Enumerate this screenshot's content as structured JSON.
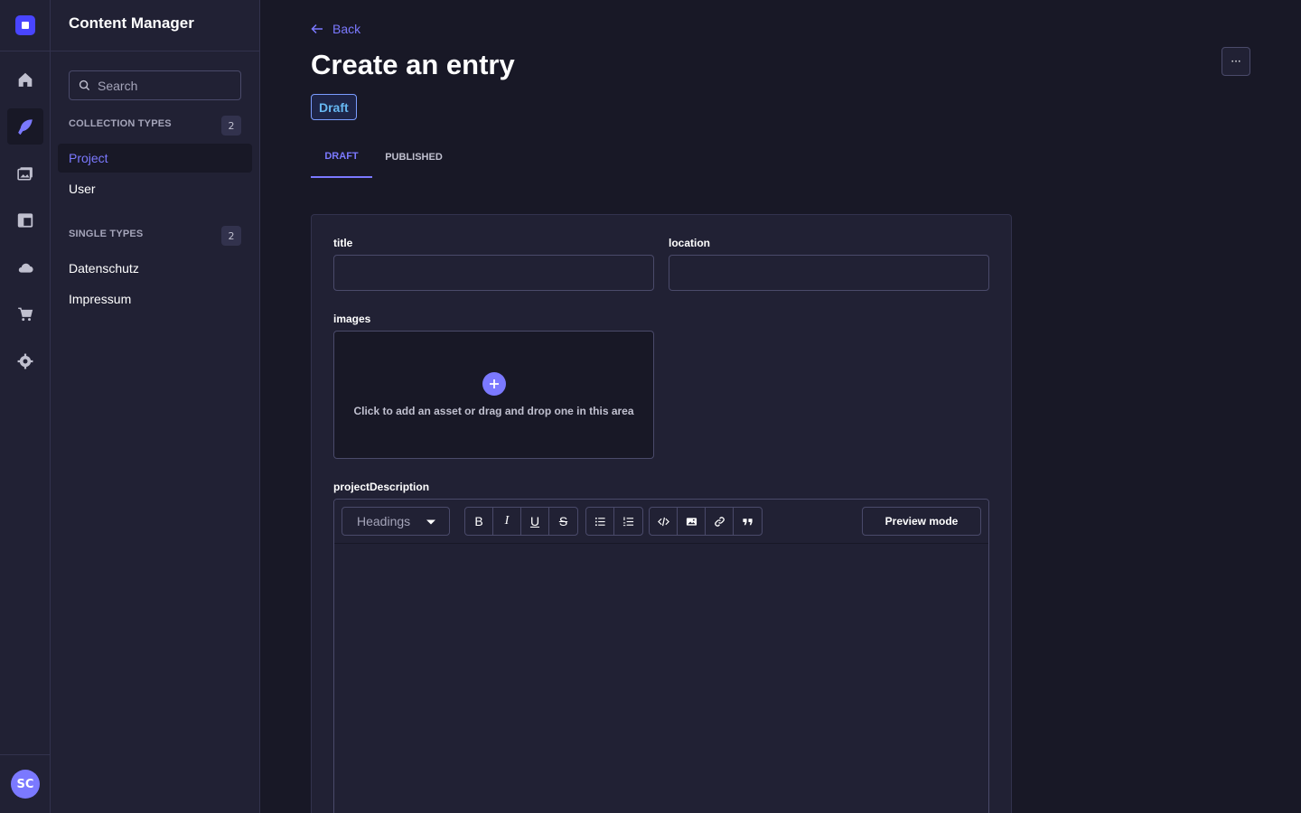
{
  "app": {
    "title": "Content Manager"
  },
  "rail": {
    "items": [
      {
        "icon": "logo-icon"
      },
      {
        "icon": "home-icon"
      },
      {
        "icon": "feather-icon",
        "active": true
      },
      {
        "icon": "media-library-icon"
      },
      {
        "icon": "layout-icon"
      },
      {
        "icon": "cloud-icon"
      },
      {
        "icon": "cart-icon"
      },
      {
        "icon": "gear-icon"
      }
    ],
    "avatar_initials": "SC"
  },
  "subnav": {
    "search_placeholder": "Search",
    "collection_types": {
      "label": "COLLECTION TYPES",
      "count": "2",
      "items": [
        {
          "label": "Project",
          "active": true
        },
        {
          "label": "User"
        }
      ]
    },
    "single_types": {
      "label": "SINGLE TYPES",
      "count": "2",
      "items": [
        {
          "label": "Datenschutz"
        },
        {
          "label": "Impressum"
        }
      ]
    }
  },
  "header": {
    "back_label": "Back",
    "title": "Create an entry",
    "status_badge": "Draft",
    "more_label": "···"
  },
  "tabs": [
    {
      "label": "DRAFT",
      "active": true
    },
    {
      "label": "PUBLISHED"
    }
  ],
  "form": {
    "title_label": "title",
    "title_value": "",
    "location_label": "location",
    "location_value": "",
    "images_label": "images",
    "images_prompt": "Click to add an asset or drag and drop one in this area",
    "description_label": "projectDescription",
    "editor": {
      "headings_label": "Headings",
      "bold": "B",
      "italic": "I",
      "underline": "U",
      "strike": "S",
      "preview_label": "Preview mode"
    }
  },
  "colors": {
    "accent": "#7b79ff",
    "background": "#181826",
    "surface": "#212134",
    "border": "#4a4a6a"
  }
}
